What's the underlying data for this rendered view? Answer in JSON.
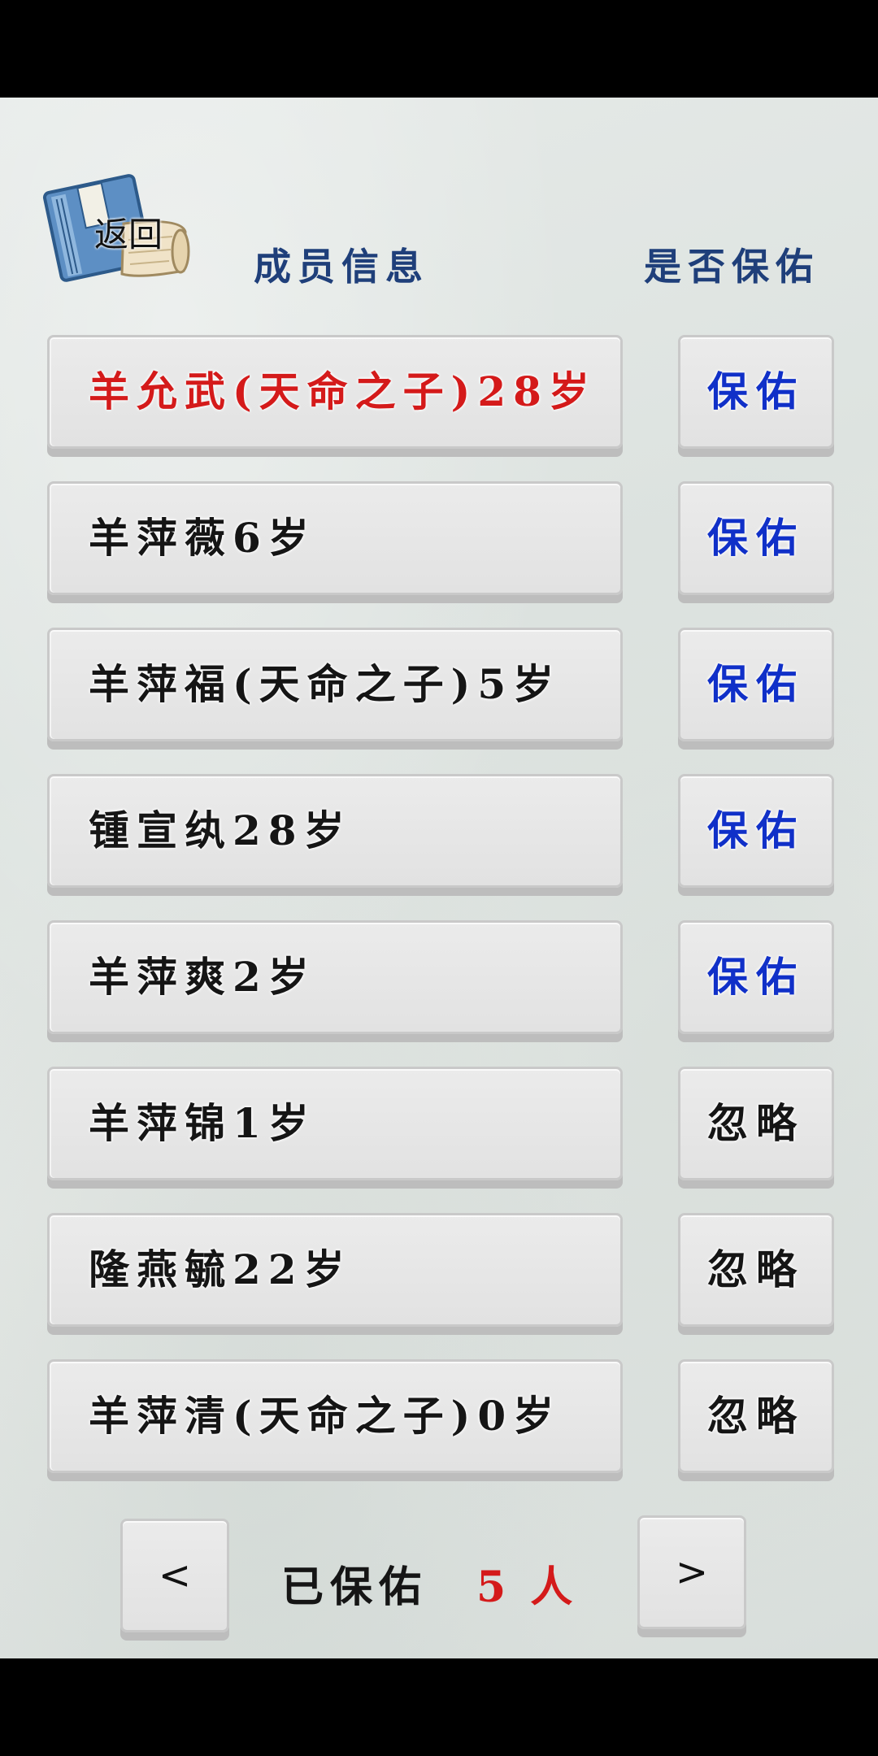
{
  "header": {
    "back_label": "返回",
    "members_title": "成员信息",
    "bless_title": "是否保佑"
  },
  "members": [
    {
      "name": "羊允武(天命之子)28岁",
      "highlight": true,
      "action": "保佑"
    },
    {
      "name": "羊萍薇6岁",
      "highlight": false,
      "action": "保佑"
    },
    {
      "name": "羊萍福(天命之子)5岁",
      "highlight": false,
      "action": "保佑"
    },
    {
      "name": "锺宣纨28岁",
      "highlight": false,
      "action": "保佑"
    },
    {
      "name": "羊萍爽2岁",
      "highlight": false,
      "action": "保佑"
    },
    {
      "name": "羊萍锦1岁",
      "highlight": false,
      "action": "忽略"
    },
    {
      "name": "隆燕毓22岁",
      "highlight": false,
      "action": "忽略"
    },
    {
      "name": "羊萍清(天命之子)0岁",
      "highlight": false,
      "action": "忽略"
    }
  ],
  "footer": {
    "prev_label": "<",
    "next_label": ">",
    "summary_label": "已保佑",
    "blessed_count": "5",
    "unit": "人"
  },
  "colors": {
    "header_text": "#1f3f7a",
    "bless_text": "#1030c8",
    "highlight_text": "#d41a1a"
  }
}
